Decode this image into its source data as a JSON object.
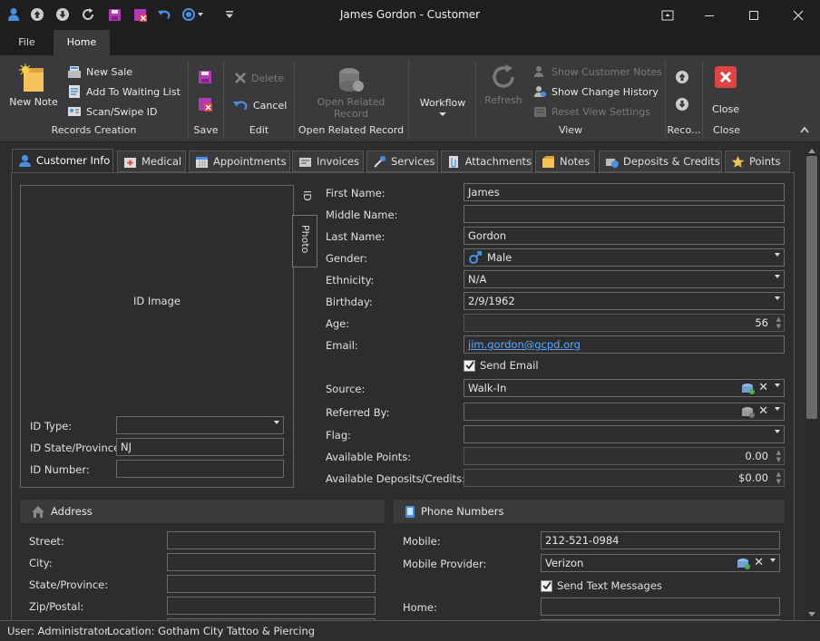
{
  "window": {
    "title": "James Gordon - Customer"
  },
  "menu_tabs": [
    "File",
    "Home"
  ],
  "ribbon": {
    "new_note": "New Note",
    "new_sale": "New Sale",
    "add_waiting": "Add To Waiting List",
    "scan_swipe": "Scan/Swipe ID",
    "records_creation": "Records Creation",
    "save": "Save",
    "delete": "Delete",
    "cancel": "Cancel",
    "edit": "Edit",
    "open_related_line1": "Open Related",
    "open_related_line2": "Record",
    "open_related_group": "Open Related Record",
    "workflow": "Workflow",
    "refresh": "Refresh",
    "show_customer_notes": "Show Customer Notes",
    "show_change_history": "Show Change History",
    "reset_view_settings": "Reset View Settings",
    "view": "View",
    "records_group": "Reco...",
    "close": "Close",
    "close_group": "Close"
  },
  "content_tabs": [
    "Customer Info",
    "Medical",
    "Appointments",
    "Invoices",
    "Services",
    "Attachments",
    "Notes",
    "Deposits & Credits",
    "Points"
  ],
  "id_panel": {
    "id_image_label": "ID Image",
    "vtab_id": "ID",
    "vtab_photo": "Photo",
    "id_type_label": "ID Type:",
    "id_type_value": "",
    "id_state_label": "ID State/Province:",
    "id_state_value": "NJ",
    "id_number_label": "ID Number:",
    "id_number_value": ""
  },
  "customer": {
    "first_name_label": "First Name:",
    "first_name": "James",
    "middle_name_label": "Middle Name:",
    "middle_name": "",
    "last_name_label": "Last Name:",
    "last_name": "Gordon",
    "gender_label": "Gender:",
    "gender": "Male",
    "ethnicity_label": "Ethnicity:",
    "ethnicity": "N/A",
    "birthday_label": "Birthday:",
    "birthday": "2/9/1962",
    "age_label": "Age:",
    "age": "56",
    "email_label": "Email:",
    "email": "jim.gordon@gcpd.org",
    "send_email_label": "Send Email",
    "send_email": true,
    "source_label": "Source:",
    "source": "Walk-In",
    "referred_by_label": "Referred By:",
    "referred_by": "",
    "flag_label": "Flag:",
    "flag": "",
    "available_points_label": "Available Points:",
    "available_points": "0.00",
    "available_deposits_label": "Available Deposits/Credits:",
    "available_deposits": "$0.00"
  },
  "address": {
    "header": "Address",
    "street_label": "Street:",
    "street": "",
    "city_label": "City:",
    "city": "",
    "state_label": "State/Province:",
    "state": "",
    "zip_label": "Zip/Postal:",
    "zip": ""
  },
  "phone": {
    "header": "Phone Numbers",
    "mobile_label": "Mobile:",
    "mobile": "212-521-0984",
    "provider_label": "Mobile Provider:",
    "provider": "Verizon",
    "send_text_label": "Send Text Messages",
    "send_text": true,
    "home_label": "Home:",
    "home": ""
  },
  "status": {
    "user": "User: Administrator",
    "location": "Location: Gotham City Tattoo & Piercing"
  },
  "colors": {
    "accent": "#4a90e2",
    "close_red": "#e04343",
    "link": "#5aa9ff"
  }
}
